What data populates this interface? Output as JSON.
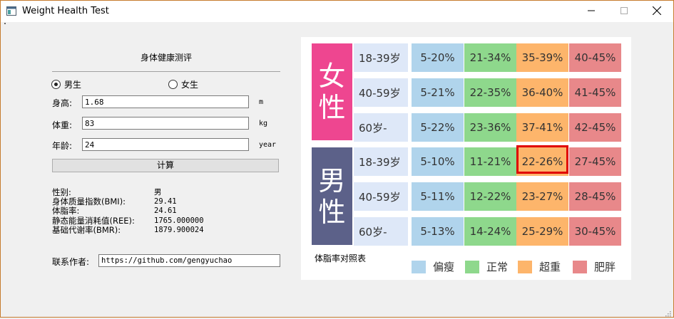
{
  "window": {
    "title": "Weight Health Test"
  },
  "form": {
    "title": "身体健康测评",
    "gender_male": "男生",
    "gender_female": "女生",
    "selected": "male",
    "height": {
      "label": "身高:",
      "value": "1.68",
      "unit": "m"
    },
    "weight": {
      "label": "体重:",
      "value": "83",
      "unit": "kg"
    },
    "age": {
      "label": "年龄:",
      "value": "24",
      "unit": "year"
    },
    "calc_label": "计算"
  },
  "results": [
    {
      "label": "性别:",
      "value": "男"
    },
    {
      "label": "身体质量指数(BMI):",
      "value": "29.41"
    },
    {
      "label": "体脂率:",
      "value": "24.61"
    },
    {
      "label": "静态能量消耗值(REE):",
      "value": "1765.000000"
    },
    {
      "label": "基础代谢率(BMR):",
      "value": "1879.900024"
    }
  ],
  "contact": {
    "label": "联系作者:",
    "value": "https://github.com/gengyuchao"
  },
  "table": {
    "caption": "体脂率对照表",
    "female": {
      "label": [
        "女",
        "性"
      ],
      "rows": [
        {
          "age": "18-39岁",
          "values": [
            "5-20%",
            "21-34%",
            "35-39%",
            "40-45%"
          ]
        },
        {
          "age": "40-59岁",
          "values": [
            "5-21%",
            "22-35%",
            "36-40%",
            "41-45%"
          ]
        },
        {
          "age": "60岁-",
          "values": [
            "5-22%",
            "23-36%",
            "37-41%",
            "42-45%"
          ]
        }
      ]
    },
    "male": {
      "label": [
        "男",
        "性"
      ],
      "rows": [
        {
          "age": "18-39岁",
          "values": [
            "5-10%",
            "11-21%",
            "22-26%",
            "27-45%"
          ]
        },
        {
          "age": "40-59岁",
          "values": [
            "5-11%",
            "12-22%",
            "23-27%",
            "28-45%"
          ]
        },
        {
          "age": "60岁-",
          "values": [
            "5-13%",
            "14-24%",
            "25-29%",
            "30-45%"
          ]
        }
      ]
    },
    "highlighted": {
      "group": "male",
      "row": 0,
      "col": 2
    },
    "legend": [
      "偏瘦",
      "正常",
      "超重",
      "肥胖"
    ]
  },
  "colors": {
    "female": "#ee4690",
    "male": "#5c6189",
    "age_bg": "#dee8f8",
    "thin": "#b0d4ec",
    "normal": "#8ed88c",
    "overweight": "#fdb56b",
    "obese": "#e8888a",
    "highlight": "#e00000"
  }
}
